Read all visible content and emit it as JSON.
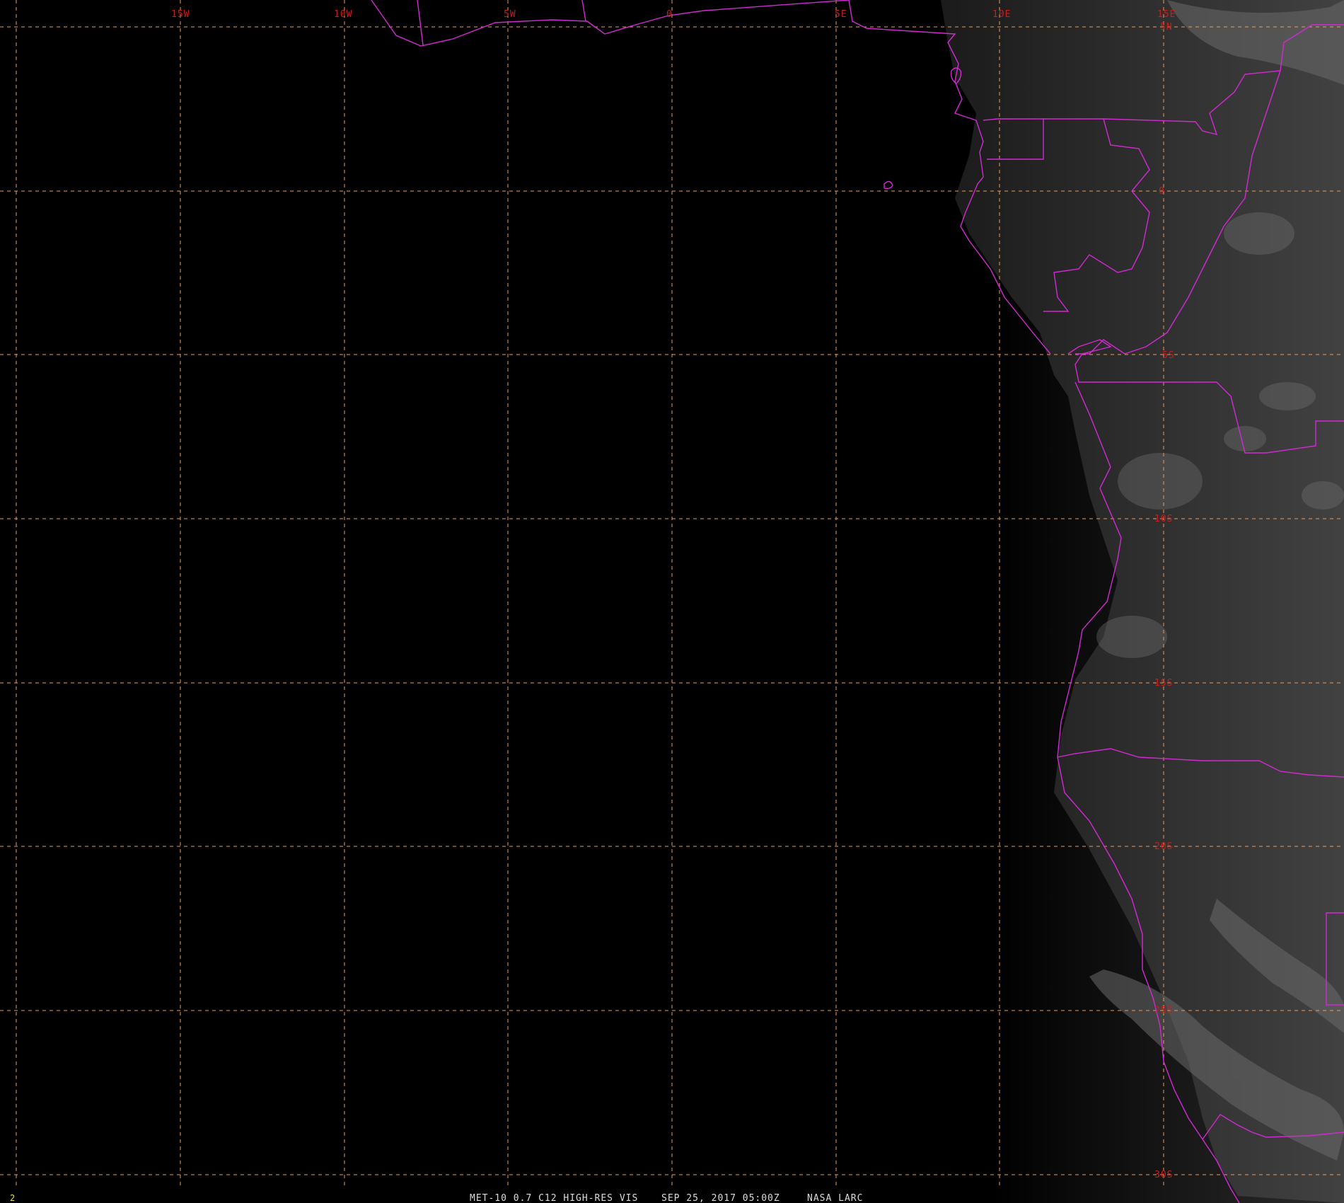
{
  "map": {
    "longitude_labels": [
      "15W",
      "10W",
      "5W",
      "0",
      "5E",
      "10E",
      "15E"
    ],
    "latitude_labels": [
      "5N",
      "0",
      "5S",
      "10S",
      "15S",
      "20S",
      "25S",
      "30S"
    ],
    "colors": {
      "background": "#000000",
      "gridline": "#e0a060",
      "coastline": "#d22ad2",
      "grid_label": "#c81e1e",
      "footer_text": "#dcdcdc",
      "frame_number": "#e6e632"
    }
  },
  "footer": {
    "satellite_line": "MET-10 0.7 C12 HIGH-RES VIS",
    "date_time": "SEP 25, 2017 05:00Z",
    "source": "NASA LARC"
  },
  "frame_number": "2"
}
